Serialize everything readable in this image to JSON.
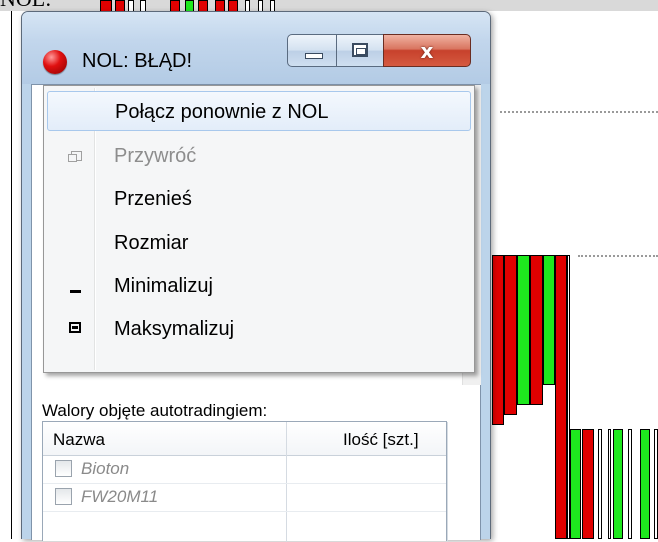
{
  "background": {
    "top_label": "NOL:"
  },
  "window": {
    "title": "NOL: BŁĄD!",
    "caption_buttons": {
      "minimize_icon": "minimize-icon",
      "maximize_icon": "maximize-icon",
      "close_glyph": "x"
    }
  },
  "system_menu": {
    "items": [
      {
        "label": "Połącz ponownie z NOL",
        "enabled": true,
        "highlighted": true,
        "icon": ""
      },
      {
        "label": "Przywróć",
        "enabled": false,
        "highlighted": false,
        "icon": "restore-icon"
      },
      {
        "label": "Przenieś",
        "enabled": true,
        "highlighted": false,
        "icon": ""
      },
      {
        "label": "Rozmiar",
        "enabled": true,
        "highlighted": false,
        "icon": ""
      },
      {
        "label": "Minimalizuj",
        "enabled": true,
        "highlighted": false,
        "icon": "minimize-icon"
      },
      {
        "label": "Maksymalizuj",
        "enabled": true,
        "highlighted": false,
        "icon": "maximize-icon"
      }
    ]
  },
  "autotrading": {
    "label": "Walory objęte autotradingiem:",
    "columns": [
      "Nazwa",
      "Ilość [szt.]"
    ],
    "rows": [
      {
        "name": "Bioton",
        "checked": false
      },
      {
        "name": "FW20M11",
        "checked": false
      }
    ]
  },
  "colors": {
    "candle_up": "#1ee81e",
    "candle_down": "#e00000",
    "title_icon": "#e01010"
  }
}
